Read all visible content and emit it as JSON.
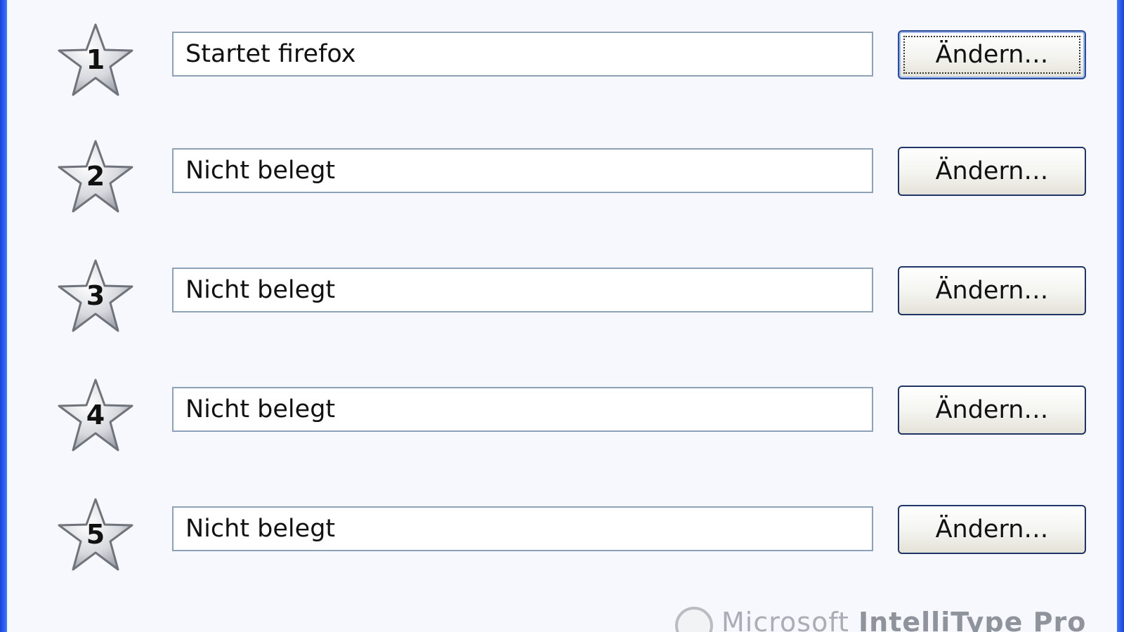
{
  "rows": [
    {
      "number": "1",
      "value": "Startet firefox",
      "button_label": "Ändern…"
    },
    {
      "number": "2",
      "value": "Nicht belegt",
      "button_label": "Ändern…"
    },
    {
      "number": "3",
      "value": "Nicht belegt",
      "button_label": "Ändern…"
    },
    {
      "number": "4",
      "value": "Nicht belegt",
      "button_label": "Ändern…"
    },
    {
      "number": "5",
      "value": "Nicht belegt",
      "button_label": "Ändern…"
    }
  ],
  "footer": {
    "brand_light": "Microsoft",
    "brand_bold": "IntelliType Pro"
  },
  "colors": {
    "window_border": "#2f62f0",
    "background": "#f7f8fd",
    "field_border": "#8da2b6",
    "button_border": "#1f3566"
  },
  "icons": {
    "star": "favorite-star-icon",
    "logo": "microsoft-logo-icon"
  }
}
